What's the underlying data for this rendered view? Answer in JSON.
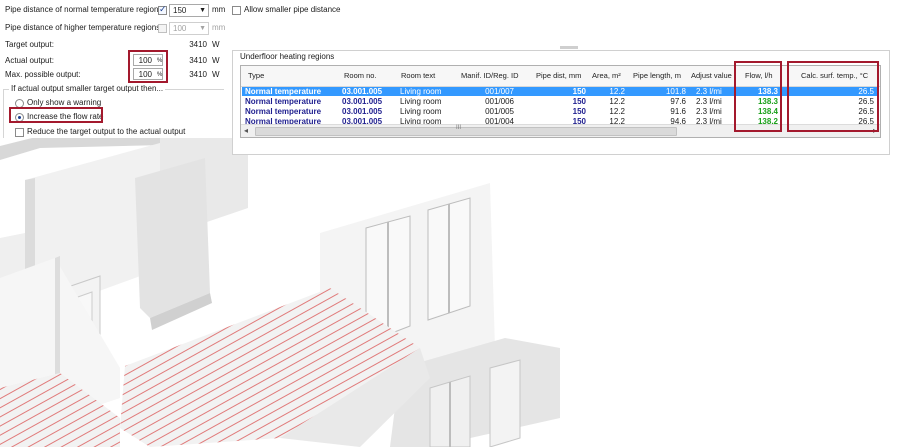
{
  "settings": {
    "pipe_distance_normal_label": "Pipe distance of normal temperature regions",
    "pipe_distance_normal_value": "150",
    "pipe_distance_unit": "mm",
    "allow_smaller_label": "Allow smaller pipe distance",
    "pipe_distance_higher_label": "Pipe distance of higher temperature regions",
    "pipe_distance_higher_value": "100",
    "target_output_label": "Target output:",
    "target_output_value": "3410",
    "actual_output_label": "Actual output:",
    "actual_output_pct": "100",
    "actual_output_value": "3410",
    "max_output_label": "Max. possible output:",
    "max_output_pct": "100",
    "max_output_value": "3410",
    "pct_unit": "%",
    "watt_unit": "W",
    "group_label": "If actual output smaller target output then...",
    "option_warning": "Only show a warning",
    "option_flow": "Increase the flow rate",
    "option_reduce": "Reduce the target output to the actual output"
  },
  "table": {
    "title": "Underfloor heating regions",
    "columns": [
      "Type",
      "Room no.",
      "Room text",
      "Manif. ID/Reg. ID",
      "Pipe dist, mm",
      "Area, m²",
      "Pipe length, m",
      "Adjust value",
      "Flow, l/h",
      "Calc. surf. temp., °C"
    ],
    "rows": [
      {
        "type": "Normal temperature",
        "room_no": "03.001.005",
        "room_text": "Living room",
        "manif": "001/007",
        "pipe_dist": "150",
        "area": "12.2",
        "length": "101.8",
        "adjust": "2.3 l/mi",
        "flow": "138.3",
        "temp": "26.5"
      },
      {
        "type": "Normal temperature",
        "room_no": "03.001.005",
        "room_text": "Living room",
        "manif": "001/006",
        "pipe_dist": "150",
        "area": "12.2",
        "length": "97.6",
        "adjust": "2.3 l/mi",
        "flow": "138.3",
        "temp": "26.5"
      },
      {
        "type": "Normal temperature",
        "room_no": "03.001.005",
        "room_text": "Living room",
        "manif": "001/005",
        "pipe_dist": "150",
        "area": "12.2",
        "length": "91.6",
        "adjust": "2.3 l/mi",
        "flow": "138.4",
        "temp": "26.5"
      },
      {
        "type": "Normal temperature",
        "room_no": "03.001.005",
        "room_text": "Living room",
        "manif": "001/004",
        "pipe_dist": "150",
        "area": "12.2",
        "length": "94.6",
        "adjust": "2.3 l/mi",
        "flow": "138.2",
        "temp": "26.5"
      }
    ],
    "scroll_grip": "III"
  },
  "colors": {
    "highlight_red": "#a3192d",
    "selection_blue": "#3399ff",
    "flow_green": "#19a019",
    "heating_pipe": "#e07a7a"
  }
}
